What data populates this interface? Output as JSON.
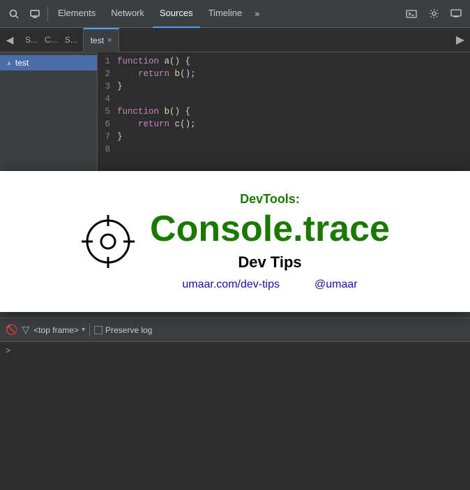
{
  "toolbar": {
    "tabs": [
      {
        "label": "Elements",
        "active": false
      },
      {
        "label": "Network",
        "active": false
      },
      {
        "label": "Sources",
        "active": true
      },
      {
        "label": "Timeline",
        "active": false
      }
    ],
    "more_label": "»",
    "icons": [
      "search",
      "device",
      "terminal",
      "gear",
      "monitor"
    ]
  },
  "file_tabs_bar": {
    "nav_left": "◀",
    "panel_tabs": [
      "S...",
      "C...",
      "S..."
    ],
    "active_file": "test",
    "close": "×",
    "nav_right": "▶"
  },
  "sidebar": {
    "items": [
      {
        "label": "test",
        "selected": true
      }
    ]
  },
  "code": {
    "lines": [
      {
        "num": 1,
        "content": "function a() {"
      },
      {
        "num": 2,
        "content": "    return b();"
      },
      {
        "num": 3,
        "content": "}"
      },
      {
        "num": 4,
        "content": ""
      },
      {
        "num": 5,
        "content": "function b() {"
      },
      {
        "num": 6,
        "content": "    return c();"
      },
      {
        "num": 7,
        "content": "}"
      },
      {
        "num": 8,
        "content": ""
      }
    ]
  },
  "overlay": {
    "subtitle": "DevTools:",
    "title": "Console.trace",
    "description": "Dev Tips",
    "link1": "umaar.com/dev-tips",
    "link2": "@umaar"
  },
  "console_bar": {
    "frame_label": "<top frame>",
    "preserve_label": "Preserve log"
  },
  "console_prompt": ">"
}
